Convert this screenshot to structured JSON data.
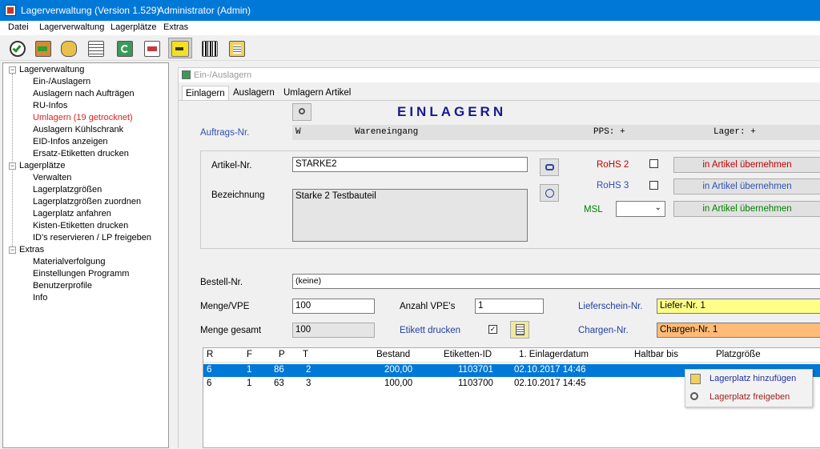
{
  "window": {
    "title": "Lagerverwaltung (Version 1.529)",
    "user": "Administrator (Admin)"
  },
  "menu": [
    "Datei",
    "Lagerverwaltung",
    "Lagerplätze",
    "Extras"
  ],
  "toolbar_icons": [
    "check-icon",
    "exit-door-icon",
    "keys-icon",
    "list-icon",
    "refresh-icon",
    "document-icon",
    "arrow-right-icon",
    "barcode-icon",
    "clipboard-icon"
  ],
  "tree": {
    "g1": {
      "label": "Lagerverwaltung",
      "items": [
        "Ein-/Auslagern",
        "Auslagern nach Aufträgen",
        "RU-Infos",
        "Umlagern (19 getrocknet)",
        "Auslagern Kühlschrank",
        "EID-Infos anzeigen",
        "Ersatz-Etiketten drucken"
      ]
    },
    "g2": {
      "label": "Lagerplätze",
      "items": [
        "Verwalten",
        "Lagerplatzgrößen",
        "Lagerplatzgrößen zuordnen",
        "Lagerplatz anfahren",
        "Kisten-Etiketten drucken",
        "ID's reservieren / LP freigeben"
      ]
    },
    "g3": {
      "label": "Extras",
      "items": [
        "Materialverfolgung",
        "Einstellungen Programm",
        "Benutzerprofile",
        "Info"
      ]
    }
  },
  "child": {
    "title": "Ein-/Auslagern",
    "tabs": [
      "Einlagern",
      "Auslagern",
      "Umlagern Artikel"
    ]
  },
  "form": {
    "heading": "EINLAGERN",
    "auftrag_label": "Auftrags-Nr.",
    "auftrag_w": "W",
    "auftrag_text": "Wareneingang",
    "auftrag_pps": "PPS: +",
    "auftrag_lager": "Lager: +",
    "artikel_label": "Artikel-Nr.",
    "artikel_value": "STARKE2",
    "bez_label": "Bezeichnung",
    "bez_value": "Starke 2 Testbauteil",
    "rohs2": "RoHS 2",
    "rohs3": "RoHS 3",
    "msl": "MSL",
    "btn1": "in Artikel übernehmen",
    "btn2": "in Artikel übernehmen",
    "btn3": "in Artikel übernehmen",
    "bestell_label": "Bestell-Nr.",
    "bestell_value": "(keine)",
    "menge_vpe_label": "Menge/VPE",
    "menge_vpe_value": "100",
    "anzahl_label": "Anzahl VPE's",
    "anzahl_value": "1",
    "liefer_label": "Lieferschein-Nr.",
    "liefer_value": "Liefer-Nr. 1",
    "menge_ges_label": "Menge gesamt",
    "menge_ges_value": "100",
    "etikett_label": "Etikett drucken",
    "chargen_label": "Chargen-Nr.",
    "chargen_value": "Chargen-Nr. 1"
  },
  "grid": {
    "headers": [
      "R",
      "F",
      "P",
      "T",
      "Bestand",
      "Etiketten-ID",
      "1. Einlagerdatum",
      "Haltbar bis",
      "Platzgröße"
    ],
    "rows": [
      [
        "6",
        "1",
        "86",
        "2",
        "200,00",
        "1103701",
        "02.10.2017 14:46",
        ""
      ],
      [
        "6",
        "1",
        "63",
        "3",
        "100,00",
        "1103700",
        "02.10.2017 14:45",
        ""
      ]
    ]
  },
  "context_menu": [
    "Lagerplatz hinzufügen",
    "Lagerplatz freigeben"
  ],
  "colors": {
    "titlebar": "#0078d7",
    "selection": "#0078d7",
    "heading": "#1a1a8c",
    "red": "#c00000",
    "blue": "#3050b0",
    "green": "#008000",
    "lieferschein_bg": "#ffff88",
    "chargen_bg": "#ffbb77"
  }
}
